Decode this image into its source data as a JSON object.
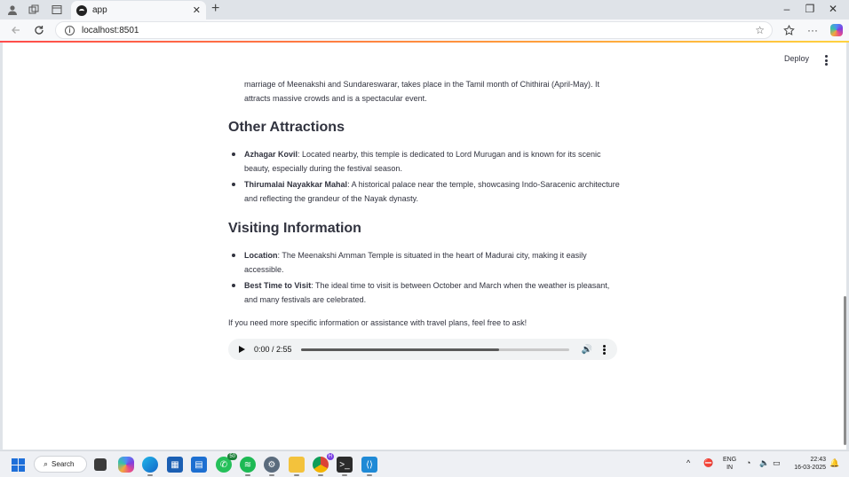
{
  "browser": {
    "tab_title": "app",
    "tab_close": "✕",
    "new_tab": "+",
    "url": "localhost:8501",
    "window_controls": [
      "–",
      "❐",
      "✕"
    ]
  },
  "app": {
    "deploy_label": "Deploy",
    "intro_text": "marriage of Meenakshi and Sundareswarar, takes place in the Tamil month of Chithirai (April-May). It attracts massive crowds and is a spectacular event.",
    "sections": [
      {
        "heading": "Other Attractions",
        "items": [
          {
            "term": "Azhagar Kovil",
            "text": ": Located nearby, this temple is dedicated to Lord Murugan and is known for its scenic beauty, especially during the festival season."
          },
          {
            "term": "Thirumalai Nayakkar Mahal",
            "text": ": A historical palace near the temple, showcasing Indo-Saracenic architecture and reflecting the grandeur of the Nayak dynasty."
          }
        ]
      },
      {
        "heading": "Visiting Information",
        "items": [
          {
            "term": "Location",
            "text": ": The Meenakshi Amman Temple is situated in the heart of Madurai city, making it easily accessible."
          },
          {
            "term": "Best Time to Visit",
            "text": ": The ideal time to visit is between October and March when the weather is pleasant, and many festivals are celebrated."
          }
        ]
      }
    ],
    "closing_text": "If you need more specific information or assistance with travel plans, feel free to ask!",
    "audio": {
      "time": "0:00 / 2:55",
      "progress_fraction": 0.74
    }
  },
  "taskbar": {
    "search_label": "Search",
    "whatsapp_badge": "50",
    "chrome_badge": "H",
    "language": "ENG",
    "region": "IN",
    "time": "22:43",
    "date": "16-03-2025"
  }
}
